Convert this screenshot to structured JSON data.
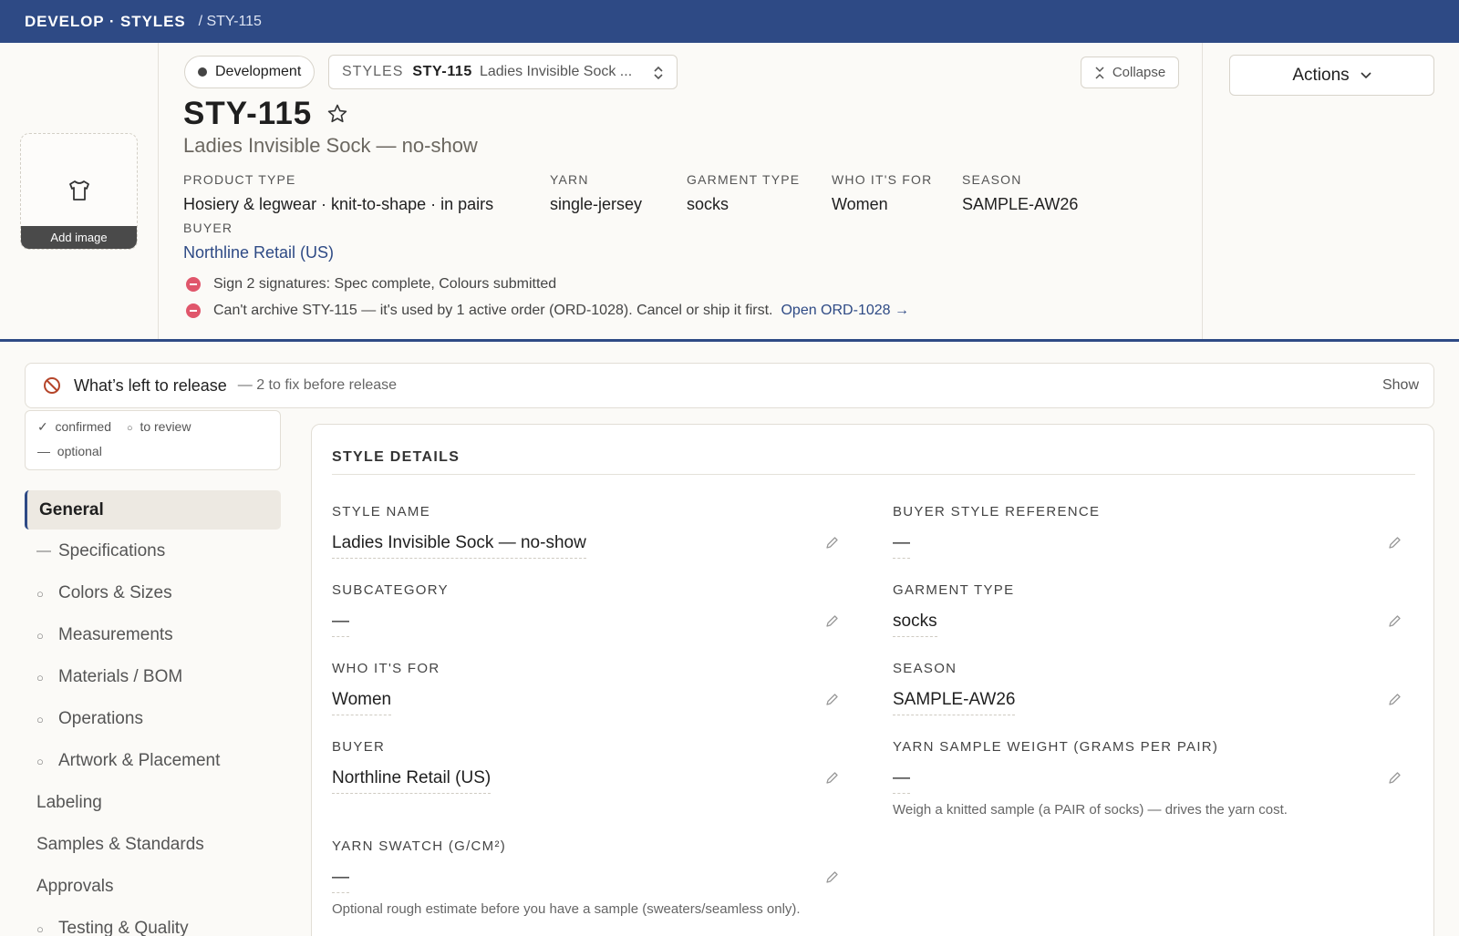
{
  "topbar": {
    "brand": "DEVELOP · STYLES",
    "crumb": "/ STY-115"
  },
  "header": {
    "status": "Development",
    "selector": {
      "label": "STYLES",
      "code": "STY-115",
      "name": "Ladies Invisible Sock ..."
    },
    "collapse_label": "Collapse",
    "actions_label": "Actions",
    "add_image_label": "Add image",
    "title": "STY-115",
    "subtitle": "Ladies Invisible Sock — no-show",
    "meta": {
      "product_type": {
        "label": "PRODUCT TYPE",
        "value": "Hosiery & legwear · knit-to-shape · in pairs"
      },
      "yarn": {
        "label": "YARN",
        "value": "single-jersey"
      },
      "garment_type": {
        "label": "GARMENT TYPE",
        "value": "socks"
      },
      "who_for": {
        "label": "WHO IT'S FOR",
        "value": "Women"
      },
      "season": {
        "label": "SEASON",
        "value": "SAMPLE-AW26"
      },
      "buyer": {
        "label": "BUYER",
        "value": "Northline Retail (US)"
      }
    },
    "warnings": [
      {
        "text": "Sign 2 signatures: Spec complete, Colours submitted",
        "link": ""
      },
      {
        "text": "Can't archive STY-115 — it's used by 1 active order (ORD-1028). Cancel or ship it first.",
        "link": "Open ORD-1028 →"
      }
    ]
  },
  "release": {
    "title": "What’s left to release",
    "summary": "— 2 to fix before release",
    "toggle": "Show"
  },
  "legend": {
    "confirmed": "confirmed",
    "to_review": "to review",
    "optional": "optional"
  },
  "nav": {
    "active": "General",
    "items": [
      {
        "marker": "—",
        "label": "Specifications"
      },
      {
        "marker": "○",
        "label": "Colors & Sizes"
      },
      {
        "marker": "○",
        "label": "Measurements"
      },
      {
        "marker": "○",
        "label": "Materials / BOM"
      },
      {
        "marker": "○",
        "label": "Operations"
      },
      {
        "marker": "○",
        "label": "Artwork & Placement"
      },
      {
        "marker": "",
        "label": "Labeling"
      },
      {
        "marker": "",
        "label": "Samples & Standards"
      },
      {
        "marker": "",
        "label": "Approvals"
      },
      {
        "marker": "○",
        "label": "Testing & Quality"
      }
    ]
  },
  "details": {
    "heading": "STYLE DETAILS",
    "style_name": {
      "label": "STYLE NAME",
      "value": "Ladies Invisible Sock — no-show"
    },
    "buyer_ref": {
      "label": "BUYER STYLE REFERENCE",
      "value": "—"
    },
    "subcategory": {
      "label": "SUBCATEGORY",
      "value": "—"
    },
    "garment_type": {
      "label": "GARMENT TYPE",
      "value": "socks"
    },
    "who_for": {
      "label": "WHO IT'S FOR",
      "value": "Women"
    },
    "season": {
      "label": "SEASON",
      "value": "SAMPLE-AW26"
    },
    "buyer": {
      "label": "BUYER",
      "value": "Northline Retail (US)"
    },
    "yarn_weight": {
      "label": "YARN SAMPLE WEIGHT (GRAMS PER PAIR)",
      "value": "—",
      "hint": "Weigh a knitted sample (a PAIR of socks) — drives the yarn cost."
    },
    "yarn_swatch": {
      "label": "YARN SWATCH (G/CM²)",
      "value": "—",
      "hint": "Optional rough estimate before you have a sample (sweaters/seamless only)."
    }
  }
}
